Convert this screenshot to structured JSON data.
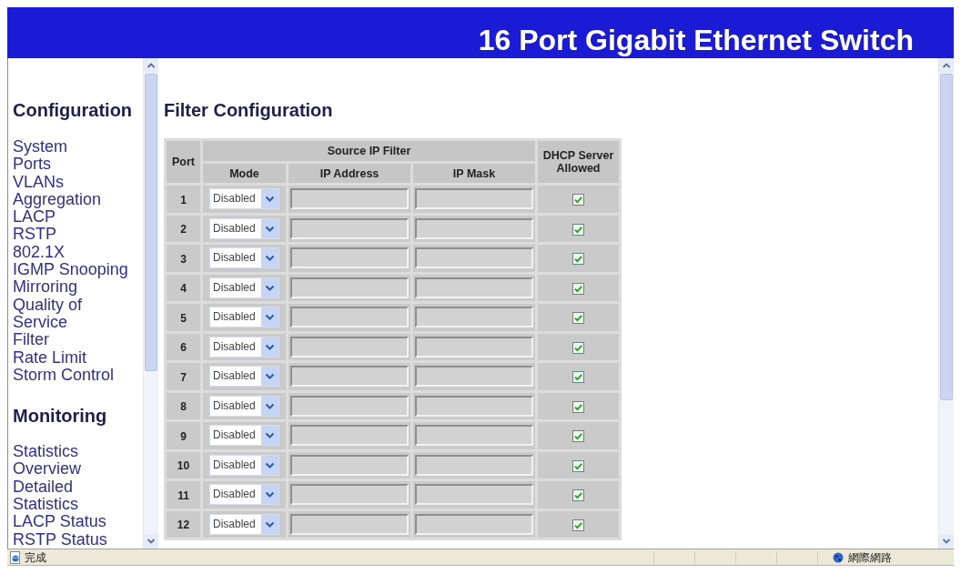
{
  "header": {
    "title": "16 Port Gigabit Ethernet Switch"
  },
  "sidebar": {
    "sections": [
      {
        "heading": "Configuration",
        "items": [
          "System",
          "Ports",
          "VLANs",
          "Aggregation",
          "LACP",
          "RSTP",
          "802.1X",
          "IGMP Snooping",
          "Mirroring",
          "Quality of Service",
          "Filter",
          "Rate Limit",
          "Storm Control"
        ]
      },
      {
        "heading": "Monitoring",
        "items": [
          "Statistics Overview",
          "Detailed Statistics",
          "LACP Status",
          "RSTP Status"
        ]
      }
    ]
  },
  "main": {
    "title": "Filter Configuration",
    "table": {
      "headers": {
        "port": "Port",
        "group": "Source IP Filter",
        "mode": "Mode",
        "ip_address": "IP Address",
        "ip_mask": "IP Mask",
        "dhcp": "DHCP Server Allowed"
      },
      "rows": [
        {
          "port": "1",
          "mode": "Disabled",
          "fields_disabled": true,
          "dhcp_allowed": true
        },
        {
          "port": "2",
          "mode": "Disabled",
          "fields_disabled": true,
          "dhcp_allowed": true
        },
        {
          "port": "3",
          "mode": "Disabled",
          "fields_disabled": true,
          "dhcp_allowed": true
        },
        {
          "port": "4",
          "mode": "Disabled",
          "fields_disabled": true,
          "dhcp_allowed": true
        },
        {
          "port": "5",
          "mode": "Disabled",
          "fields_disabled": true,
          "dhcp_allowed": true
        },
        {
          "port": "6",
          "mode": "Disabled",
          "fields_disabled": true,
          "dhcp_allowed": true
        },
        {
          "port": "7",
          "mode": "Disabled",
          "fields_disabled": true,
          "dhcp_allowed": true
        },
        {
          "port": "8",
          "mode": "Disabled",
          "fields_disabled": true,
          "dhcp_allowed": true
        },
        {
          "port": "9",
          "mode": "Disabled",
          "fields_disabled": true,
          "dhcp_allowed": true
        },
        {
          "port": "10",
          "mode": "Disabled",
          "fields_disabled": true,
          "dhcp_allowed": true
        },
        {
          "port": "11",
          "mode": "Disabled",
          "fields_disabled": true,
          "dhcp_allowed": true
        },
        {
          "port": "12",
          "mode": "Disabled",
          "fields_disabled": true,
          "dhcp_allowed": true
        }
      ]
    }
  },
  "status_bar": {
    "text": "完成",
    "zone": "網際網路"
  }
}
